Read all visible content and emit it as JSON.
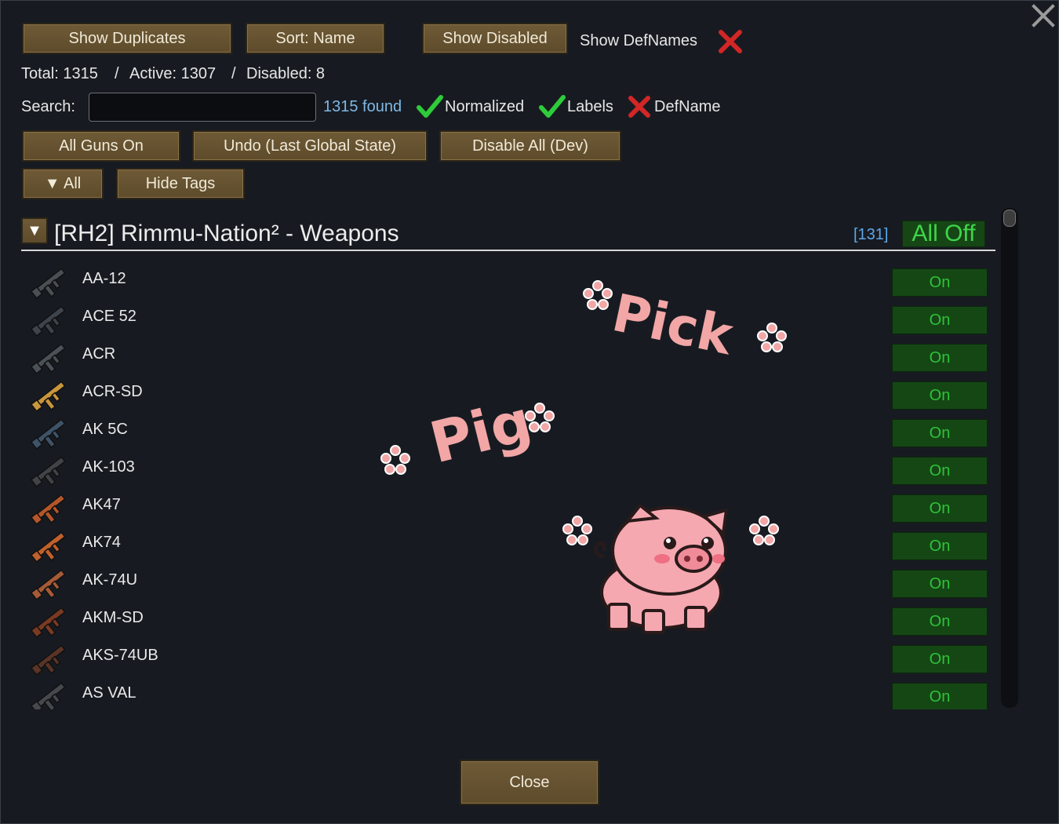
{
  "toolbar": {
    "show_duplicates": "Show Duplicates",
    "sort": "Sort: Name",
    "show_disabled": "Show Disabled",
    "show_defnames": "Show DefNames"
  },
  "stats": {
    "total": "Total: 1315",
    "sep1": "/",
    "active": "Active: 1307",
    "sep2": "/",
    "disabled": "Disabled: 8"
  },
  "search": {
    "label": "Search:",
    "value": "",
    "found": "1315 found",
    "filters": {
      "normalized": "Normalized",
      "labels": "Labels",
      "defname": "DefName"
    }
  },
  "actions": {
    "all_guns_on": "All Guns On",
    "undo": "Undo (Last Global State)",
    "disable_all": "Disable All (Dev)",
    "all_dropdown": "▼ All",
    "hide_tags": "Hide Tags"
  },
  "group": {
    "collapse_glyph": "▼",
    "title": "[RH2] Rimmu-Nation² - Weapons",
    "count": "[131]",
    "all_off": "All Off"
  },
  "weapons": [
    {
      "name": "AA-12",
      "state": "On",
      "color": "#4a4f55"
    },
    {
      "name": "ACE 52",
      "state": "On",
      "color": "#3d444c"
    },
    {
      "name": "ACR",
      "state": "On",
      "color": "#4b5158"
    },
    {
      "name": "ACR-SD",
      "state": "On",
      "color": "#c9963c"
    },
    {
      "name": "AK 5C",
      "state": "On",
      "color": "#3f5368"
    },
    {
      "name": "AK-103",
      "state": "On",
      "color": "#404448"
    },
    {
      "name": "AK47",
      "state": "On",
      "color": "#b4562a"
    },
    {
      "name": "AK74",
      "state": "On",
      "color": "#c0602c"
    },
    {
      "name": "AK-74U",
      "state": "On",
      "color": "#a65a36"
    },
    {
      "name": "AKM-SD",
      "state": "On",
      "color": "#7a3a22"
    },
    {
      "name": "AKS-74UB",
      "state": "On",
      "color": "#5a3426"
    },
    {
      "name": "AS VAL",
      "state": "On",
      "color": "#45494e"
    }
  ],
  "overlay": {
    "word1": "Pick",
    "word2": "Pig"
  },
  "footer": {
    "close": "Close"
  },
  "colors": {
    "button": "#6e5a36",
    "on_bg": "#154715",
    "on_text": "#2fc23a",
    "found_text": "#7fb8e6",
    "pink": "#f2a6a6"
  }
}
